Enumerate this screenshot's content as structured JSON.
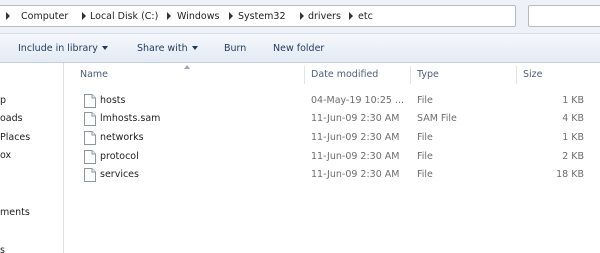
{
  "breadcrumb": [
    "Computer",
    "Local Disk (C:)",
    "Windows",
    "System32",
    "drivers",
    "etc"
  ],
  "toolbar": {
    "include_label": "Include in library",
    "share_label": "Share with",
    "burn_label": "Burn",
    "new_folder_label": "New folder"
  },
  "nav": [
    "p",
    "oads",
    "Places",
    "ox",
    "ments",
    "s"
  ],
  "columns": {
    "name": "Name",
    "date": "Date modified",
    "type": "Type",
    "size": "Size"
  },
  "files": [
    {
      "name": "hosts",
      "date": "04-May-19 10:25 ...",
      "type": "File",
      "size": "1 KB"
    },
    {
      "name": "lmhosts.sam",
      "date": "11-Jun-09 2:30 AM",
      "type": "SAM File",
      "size": "4 KB"
    },
    {
      "name": "networks",
      "date": "11-Jun-09 2:30 AM",
      "type": "File",
      "size": "1 KB"
    },
    {
      "name": "protocol",
      "date": "11-Jun-09 2:30 AM",
      "type": "File",
      "size": "2 KB"
    },
    {
      "name": "services",
      "date": "11-Jun-09 2:30 AM",
      "type": "File",
      "size": "18 KB"
    }
  ],
  "icons": {
    "breadcrumb_separator": "chevron-right-icon",
    "dropdown": "chevron-down-icon",
    "file": "file-icon"
  },
  "colors": {
    "toolbar_text": "#1e395b",
    "header_text": "#4c607a",
    "secondary_text": "#6d6d6d",
    "toolbar_bg": "#e3eaf4"
  }
}
